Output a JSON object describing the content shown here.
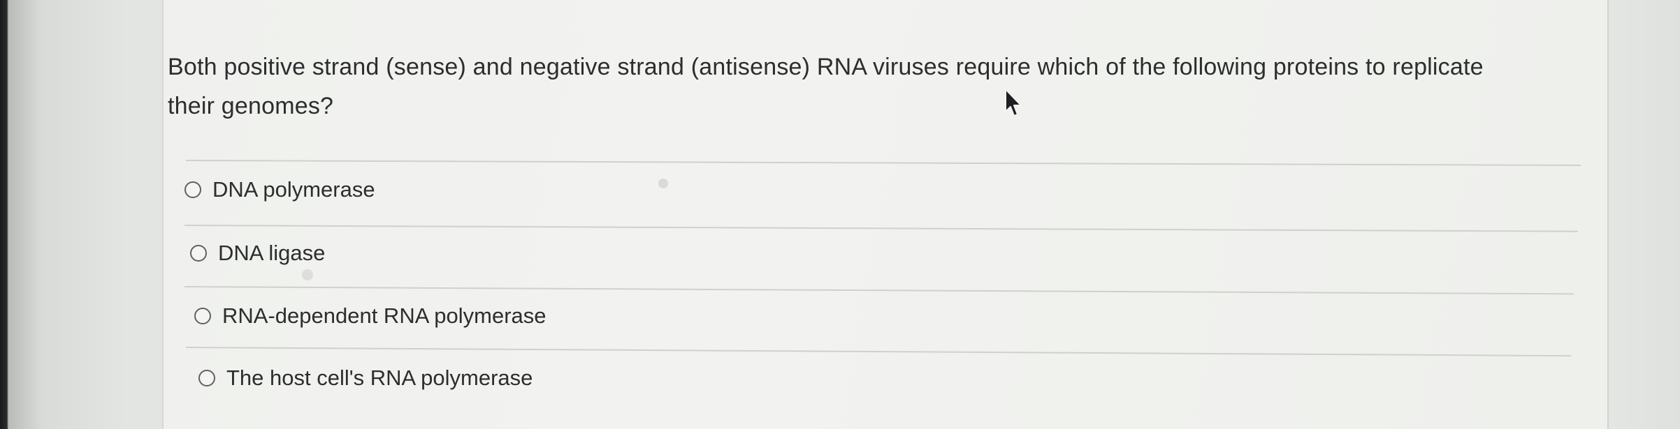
{
  "question": {
    "text": "Both positive strand (sense) and negative strand (antisense) RNA viruses require which of the following proteins to replicate their genomes?"
  },
  "options": [
    {
      "label": "DNA polymerase",
      "selected": false
    },
    {
      "label": "DNA ligase",
      "selected": false
    },
    {
      "label": "RNA-dependent RNA polymerase",
      "selected": false
    },
    {
      "label": "The host cell's RNA polymerase",
      "selected": false
    }
  ],
  "icons": {
    "cursor": "mouse-pointer-icon"
  },
  "colors": {
    "text": "#2c2d2e",
    "card": "#f1f2ef",
    "divider": "#cfd1cd",
    "radio_border": "#5e6063"
  }
}
